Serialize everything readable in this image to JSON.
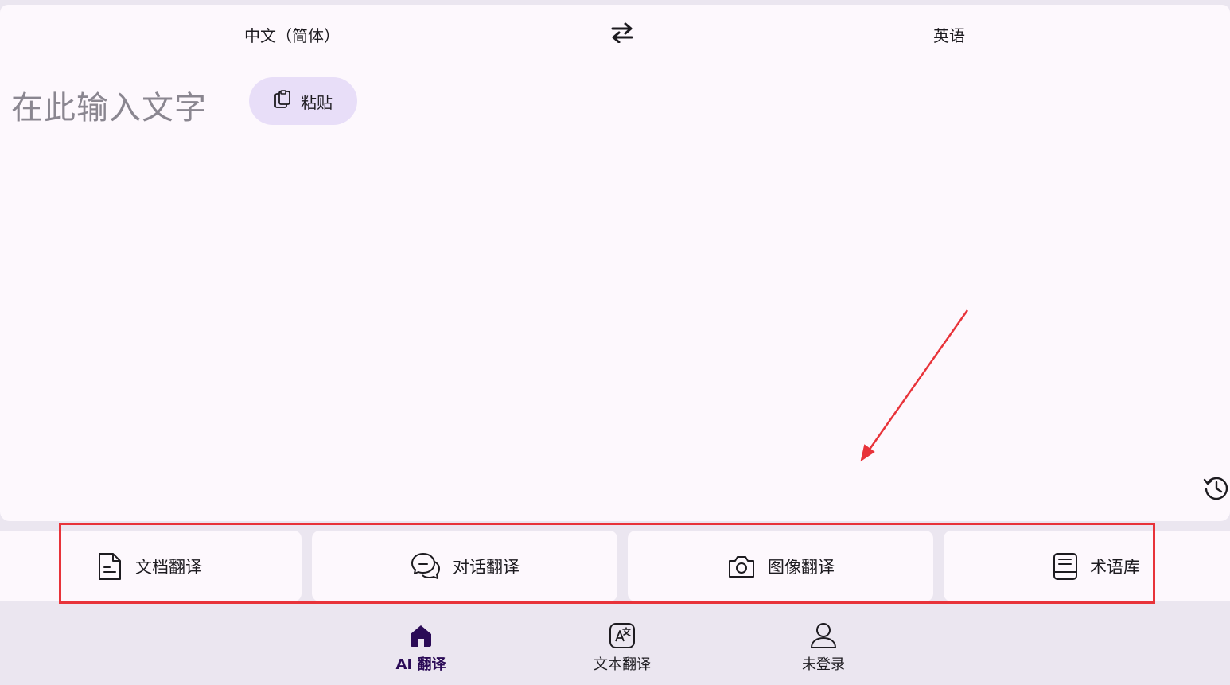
{
  "language_bar": {
    "source_language": "中文（简体）",
    "target_language": "英语",
    "swap_icon": "swap-arrows-icon"
  },
  "input": {
    "placeholder": "在此输入文字",
    "paste_label": "粘贴",
    "paste_icon": "clipboard-icon",
    "history_icon": "history-icon"
  },
  "features": [
    {
      "label": "文档翻译",
      "icon": "document-icon"
    },
    {
      "label": "对话翻译",
      "icon": "chat-bubbles-icon"
    },
    {
      "label": "图像翻译",
      "icon": "camera-icon"
    },
    {
      "label": "术语库",
      "icon": "glossary-book-icon"
    }
  ],
  "bottom_nav": [
    {
      "label": "AI 翻译",
      "icon": "home-icon",
      "active": true
    },
    {
      "label": "文本翻译",
      "icon": "text-translate-icon",
      "active": false
    },
    {
      "label": "未登录",
      "icon": "user-icon",
      "active": false
    }
  ],
  "colors": {
    "surface": "#fdf8fd",
    "background": "#ebe6f0",
    "paste_button": "#e8def8",
    "active_nav": "#2b0b57",
    "annotation_red": "#e8333a"
  }
}
